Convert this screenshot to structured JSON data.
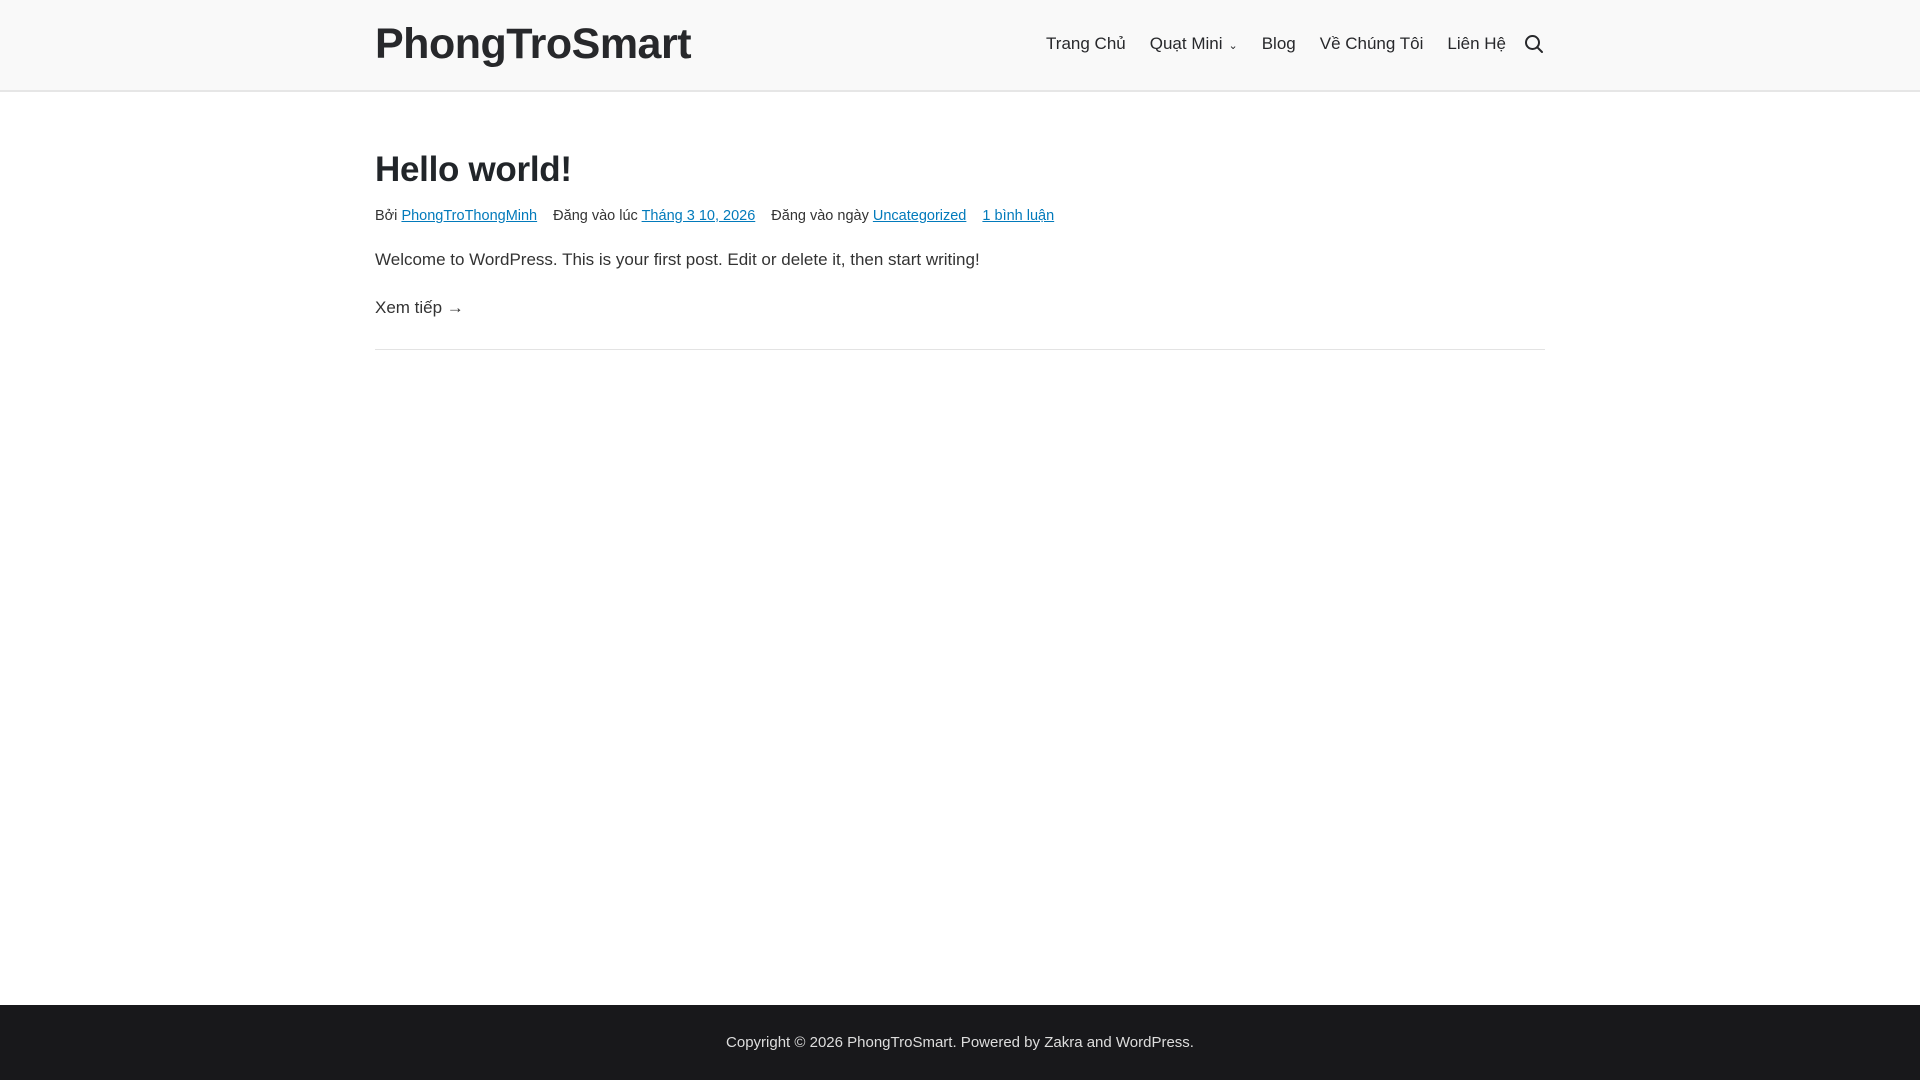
{
  "header": {
    "site_title": "PhongTroSmart",
    "nav": [
      "Trang Chủ",
      "Quạt Mini",
      "Blog",
      "Về Chúng Tôi",
      "Liên Hệ"
    ]
  },
  "post": {
    "title": "Hello world!",
    "by": "Bởi",
    "author": "PhongTroThongMinh",
    "posted_at_label": "Đăng vào lúc",
    "date": "Tháng 3 10, 2026",
    "posted_in_label": "Đăng vào ngày",
    "category": "Uncategorized",
    "comments": "1 bình luận",
    "excerpt": "Welcome to WordPress. This is your first post. Edit or delete it, then start writing!",
    "read_more": "Xem tiếp →"
  },
  "footer": {
    "text": "Copyright © 2026 PhongTroSmart. Powered by Zakra and WordPress."
  }
}
